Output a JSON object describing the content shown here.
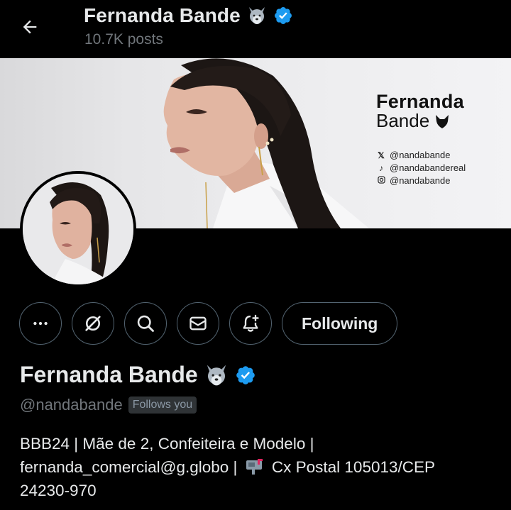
{
  "header": {
    "name": "Fernanda Bande",
    "posts": "10.7K posts"
  },
  "banner": {
    "brand_line1": "Fernanda",
    "brand_line2": "Bande",
    "handles": [
      {
        "icon": "x-logo-icon",
        "text": "@nandabande"
      },
      {
        "icon": "tiktok-icon",
        "text": "@nandabandereal"
      },
      {
        "icon": "instagram-icon",
        "text": "@nandabande"
      }
    ]
  },
  "actions": {
    "following_label": "Following"
  },
  "profile": {
    "name": "Fernanda Bande",
    "handle": "@nandabande",
    "follows_badge": "Follows you",
    "bio_line1": "BBB24 | Mãe de 2, Confeiteira e Modelo |",
    "bio_line2a": "fernanda_comercial@g.globo | ",
    "bio_line2b": " Cx Postal 105013/CEP",
    "bio_line3": "24230-970"
  },
  "colors": {
    "background": "#000000",
    "text": "#e7e9ea",
    "muted": "#71767b",
    "verified": "#1d9bf0",
    "border": "#536471"
  }
}
